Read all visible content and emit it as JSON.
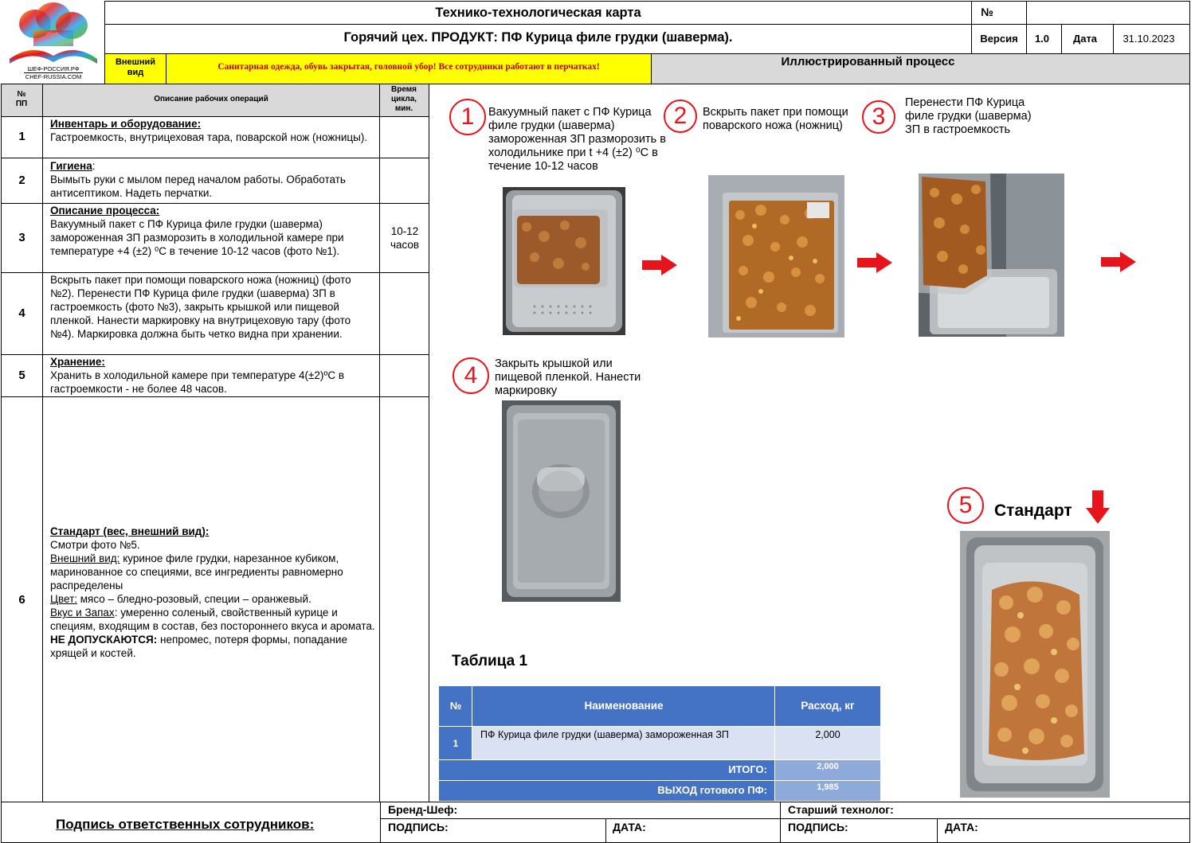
{
  "header": {
    "title": "Технико-технологическая карта",
    "subtitle": "Горячий цех. ПРОДУКТ: ПФ Курица филе грудки (шаверма).",
    "number_label": "№",
    "number_value": "",
    "version_label": "Версия",
    "version_value": "1.0",
    "date_label": "Дата",
    "date_value": "31.10.2023",
    "logo_line1": "ШЕФ-РОССИЯ.РФ",
    "logo_line2": "CHEF-RUSSIA.COM",
    "appearance_label": "Внешний вид",
    "sanitary_note": "Санитарная одежда, обувь закрытая, головной убор! Все сотрудники работают в перчатках!",
    "illustrated_title": "Иллюстрированный процесс"
  },
  "ops_table": {
    "col_num": "№ ПП",
    "col_desc": "Описание рабочих операций",
    "col_time": "Время цикла, мин.",
    "rows": [
      {
        "num": "1",
        "heading": "Инвентарь и оборудование:",
        "text": "Гастроемкость, внутрицеховая тара, поварской нож (ножницы).",
        "time": ""
      },
      {
        "num": "2",
        "heading": "Гигиена",
        "heading_suffix": ":",
        "text": "Вымыть руки с мылом перед началом работы. Обработать антисептиком. Надеть перчатки.",
        "time": ""
      },
      {
        "num": "3",
        "heading": "Описание процесса:",
        "text": "Вакуумный пакет с ПФ Курица филе грудки (шаверма) замороженная ЗП разморозить в холодильной камере при температуре +4 (±2) ⁰С в течение 10-12 часов (фото №1).",
        "time": "10-12 часов"
      },
      {
        "num": "4",
        "heading": "",
        "text": "Вскрыть пакет при помощи поварского ножа (ножниц) (фото №2). Перенести ПФ Курица филе грудки (шаверма) ЗП в гастроемкость (фото №3), закрыть крышкой или пищевой пленкой. Нанести маркировку на внутрицеховую тару (фото №4). Маркировка должна быть четко видна при хранении.",
        "time": ""
      },
      {
        "num": "5",
        "heading": "Хранение:",
        "text": "Хранить в холодильной камере при температуре 4(±2)ºС в гастроемкости - не более 48 часов.",
        "time": ""
      },
      {
        "num": "6",
        "heading": "Стандарт (вес, внешний вид):",
        "time": ""
      }
    ],
    "standard": {
      "see_photo": "Смотри фото №5.",
      "appearance_label": "Внешний вид:",
      "appearance_text": " куриное филе грудки, нарезанное кубиком, маринованное со специями, все ингредиенты равномерно распределены",
      "color_label": "Цвет:",
      "color_text": " мясо – бледно-розовый, специи – оранжевый.",
      "taste_label": "Вкус и Запах",
      "taste_text": ": умеренно соленый, свойственный курице и специям, входящим в состав, без постороннего вкуса и аромата.",
      "not_allowed_label": "НЕ ДОПУСКАЮТСЯ:",
      "not_allowed_text": " непромес, потеря формы, попадание хрящей и костей."
    }
  },
  "steps": [
    {
      "num": "1",
      "text": "Вакуумный пакет с ПФ Курица филе грудки (шаверма) замороженная ЗП разморозить в холодильнике при t +4 (±2) ⁰С в течение 10-12 часов"
    },
    {
      "num": "2",
      "text": "Вскрыть пакет при помощи поварского ножа (ножниц)"
    },
    {
      "num": "3",
      "text": "Перенести ПФ Курица филе грудки (шаверма) ЗП в гастроемкость"
    },
    {
      "num": "4",
      "text": "Закрыть крышкой или пищевой пленкой. Нанести маркировку"
    },
    {
      "num": "5",
      "text": "Стандарт"
    }
  ],
  "table1": {
    "title": "Таблица 1",
    "col_num": "№",
    "col_name": "Наименование",
    "col_usage": "Расход, кг",
    "rows": [
      {
        "num": "1",
        "name": "ПФ Курица филе грудки (шаверма) замороженная ЗП",
        "usage": "2,000"
      }
    ],
    "total_label": "ИТОГО:",
    "total_value": "2,000",
    "output_label": "ВЫХОД готового ПФ:",
    "output_value": "1,985"
  },
  "footer": {
    "signatures_label": "Подпись ответственных сотрудников:",
    "brand_chef_label": "Бренд-Шеф:",
    "signature_label": "ПОДПИСЬ:",
    "date_label": "ДАТА:",
    "senior_tech_label": "Старший технолог:",
    "signature_label2": "ПОДПИСЬ:",
    "date_label2": "ДАТА:"
  },
  "colors": {
    "accent_red": "#e8141b",
    "table_blue": "#4472c4",
    "table_light_blue": "#d9e1f2",
    "yellow": "#ffff00",
    "header_gray": "#d9d9d9"
  }
}
